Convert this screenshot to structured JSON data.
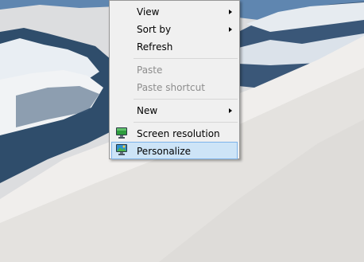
{
  "context_menu": {
    "items": [
      {
        "label": "View",
        "has_submenu": true,
        "enabled": true
      },
      {
        "label": "Sort by",
        "has_submenu": true,
        "enabled": true
      },
      {
        "label": "Refresh",
        "has_submenu": false,
        "enabled": true
      },
      {
        "label": "Paste",
        "has_submenu": false,
        "enabled": false
      },
      {
        "label": "Paste shortcut",
        "has_submenu": false,
        "enabled": false
      },
      {
        "label": "New",
        "has_submenu": true,
        "enabled": true
      },
      {
        "label": "Screen resolution",
        "icon": "monitor-icon",
        "enabled": true
      },
      {
        "label": "Personalize",
        "icon": "personalize-monitor-icon",
        "enabled": true,
        "selected": true
      }
    ]
  },
  "colors": {
    "menu_background": "#f0f0f0",
    "selected_background": "#cde4f7",
    "selected_border": "#7eb4ea",
    "disabled_text": "#8d8d8d"
  }
}
